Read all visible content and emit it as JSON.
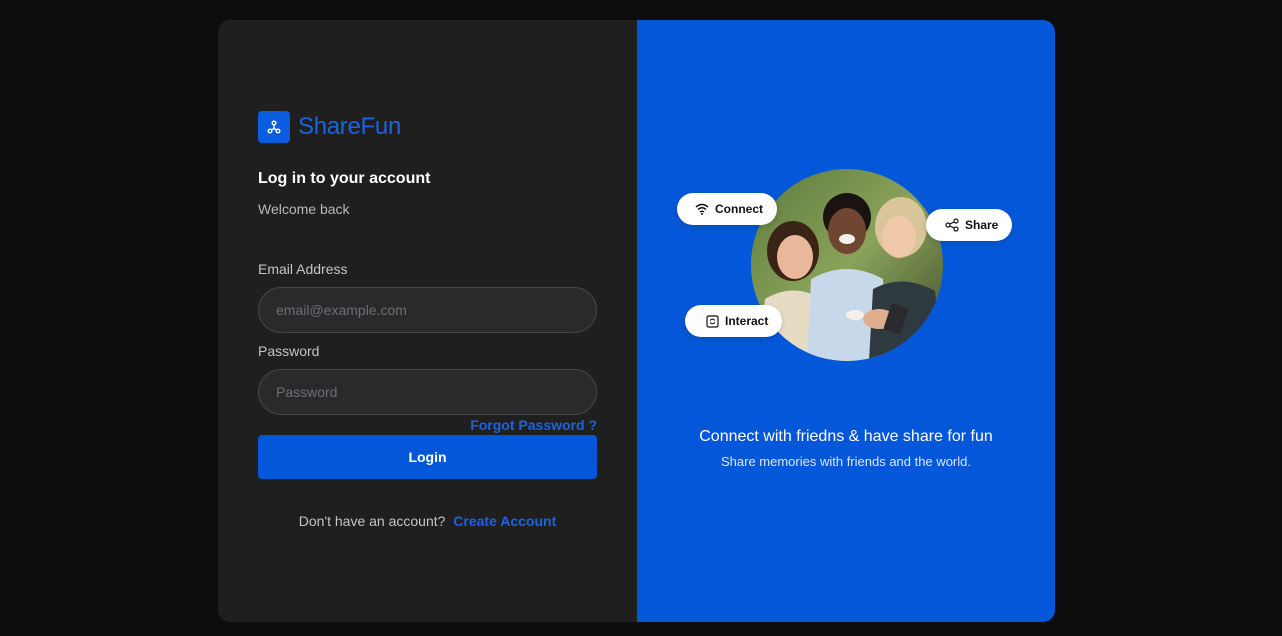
{
  "brand": {
    "name": "ShareFun",
    "color": "#1b63e0",
    "logo_icon": "share-nodes-icon"
  },
  "login": {
    "heading": "Log in to your account",
    "subheading": "Welcome back",
    "email_label": "Email Address",
    "email_placeholder": "email@example.com",
    "email_value": "",
    "password_label": "Password",
    "password_placeholder": "Password",
    "password_value": "",
    "forgot_label": "Forgot Password ?",
    "login_label": "Login",
    "signup_prompt": "Don't have an account?",
    "signup_link": "Create Account"
  },
  "promo": {
    "background": "#0557d9",
    "pills": [
      {
        "label": "Connect",
        "icon": "wifi-icon"
      },
      {
        "label": "Share",
        "icon": "share-icon"
      },
      {
        "label": "Interact",
        "icon": "interact-icon"
      }
    ],
    "tagline": "Connect with friedns & have share for fun",
    "tagline_sub": "Share memories with friends and the world."
  }
}
